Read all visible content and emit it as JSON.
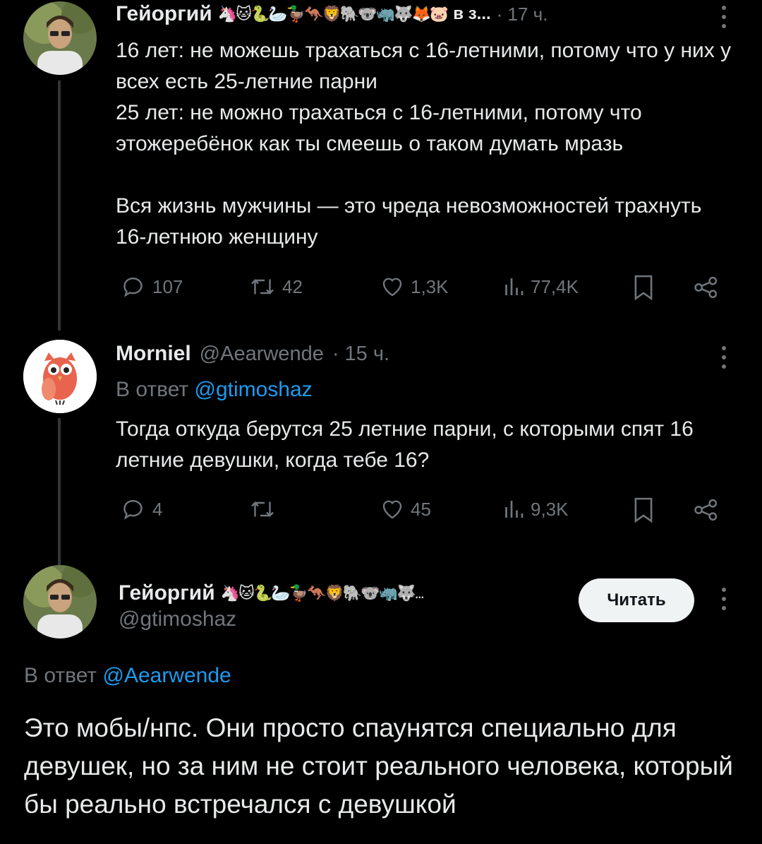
{
  "tweet1": {
    "display_name": "Гейоргий",
    "emojis": "🦄🐱🐍🦢🦆🦘🦁🐘🐨🦏🐺🦊🐷",
    "truncated_suffix": "в з...",
    "time": "· 17 ч.",
    "text": "16 лет: не можешь трахаться с 16-летними, потому что у них у всех есть 25-летние парни\n25 лет: не можно трахаться с 16-летними, потому что этожеребёнок как ты смеешь о таком думать мразь\n\nВся жизнь мужчины — это чреда невозможностей трахнуть 16-летнюю женщину",
    "replies": "107",
    "retweets": "42",
    "likes": "1,3K",
    "views": "77,4K"
  },
  "tweet2": {
    "display_name": "Morniel",
    "handle": "@Aearwende",
    "time": "· 15 ч.",
    "reply_prefix": "В ответ",
    "reply_to": "@gtimoshaz",
    "text": "Тогда откуда берутся 25 летние парни, с которыми спят 16 летние девушки, когда тебе 16?",
    "replies": "4",
    "retweets": "",
    "likes": "45",
    "views": "9,3K"
  },
  "main_tweet": {
    "display_name": "Гейоргий",
    "emojis": "🦄🐱🐍🦢🦆🦘🦁🐘🐨🦏🐺...",
    "handle": "@gtimoshaz",
    "follow_label": "Читать",
    "reply_prefix": "В ответ",
    "reply_to": "@Aearwende",
    "text": "Это мобы/нпс. Они просто спаунятся специально для девушек, но за ним не стоит реального человека, который бы реально встречался с девушкой"
  },
  "colors": {
    "background": "#000000",
    "text": "#e7e9ea",
    "muted": "#71767b",
    "link": "#1d9bf0"
  }
}
